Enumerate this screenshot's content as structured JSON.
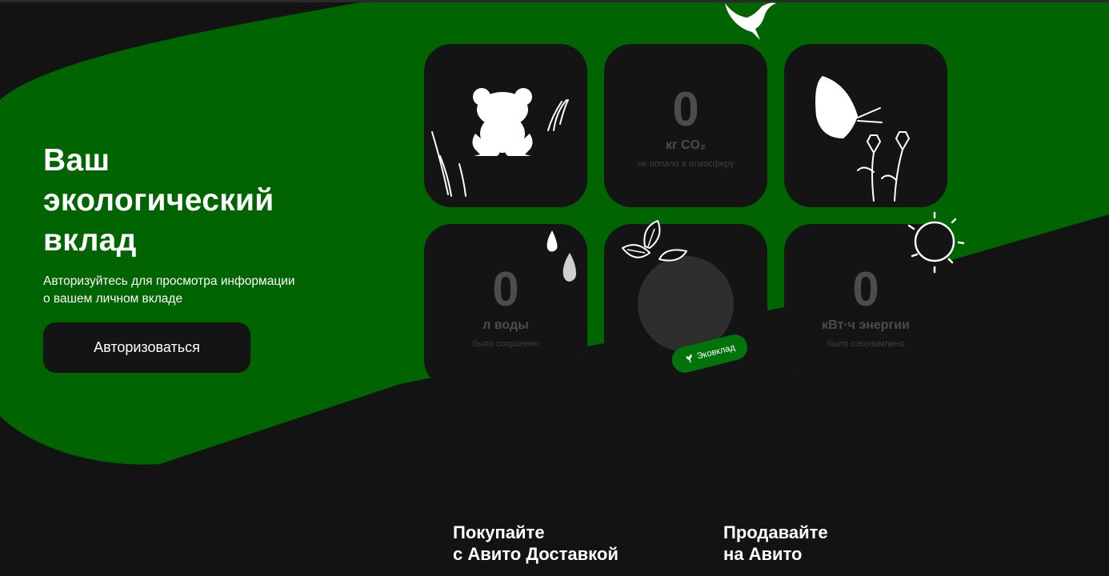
{
  "colors": {
    "brand_green": "#006400",
    "card": "#141414",
    "page": "#131313",
    "muted": "#4c4c4c",
    "badge": "#00730a"
  },
  "hero": {
    "title": "Ваш\nэкологический\nвклад",
    "subtitle": "Авторизуйтесь для просмотра информации\nо вашем личном вкладе",
    "button_label": "Авторизоваться"
  },
  "cards": [
    {
      "kind": "illustration",
      "icon": "frog-icon"
    },
    {
      "kind": "metric",
      "value": "0",
      "unit": "кг CO₂",
      "description": "не попало в атмосферу"
    },
    {
      "kind": "illustration",
      "icon": "butterfly-icon"
    },
    {
      "kind": "metric",
      "value": "0",
      "unit": "л воды",
      "description": "было сохранено"
    },
    {
      "kind": "badge",
      "label": "Эковклад",
      "icon": "leaf-icon"
    },
    {
      "kind": "metric",
      "value": "0",
      "unit": "кВт·ч энергии",
      "description": "было сэкономлено"
    }
  ],
  "decor": [
    "bird-icon",
    "grass-icon",
    "flower-icon",
    "water-drop-icon",
    "leaves-icon",
    "sun-icon"
  ],
  "promos": [
    {
      "title": "Покупайте\nс Авито Доставкой"
    },
    {
      "title": "Продавайте\nна Авито"
    }
  ]
}
